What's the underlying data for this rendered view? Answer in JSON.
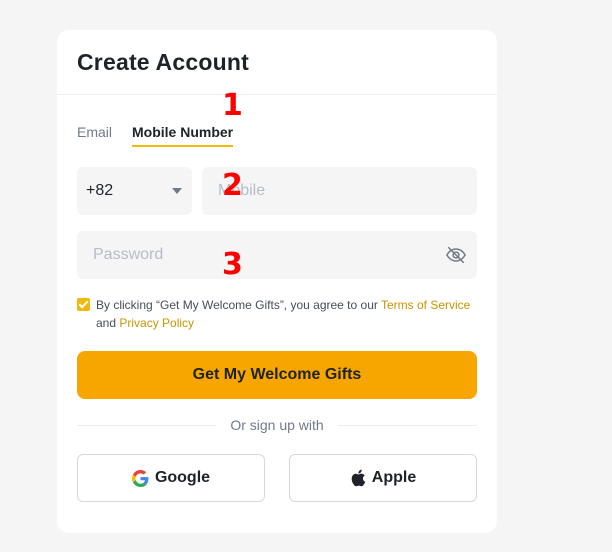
{
  "header": {
    "title": "Create Account"
  },
  "tabs": [
    {
      "label": "Email",
      "active": false
    },
    {
      "label": "Mobile Number",
      "active": true
    }
  ],
  "phone": {
    "country_code": "+82",
    "mobile_placeholder": "Mobile"
  },
  "password": {
    "placeholder": "Password"
  },
  "annotations": [
    "1",
    "2",
    "3"
  ],
  "agreement": {
    "text_before": "By clicking “Get My Welcome Gifts”, you agree to our ",
    "terms_link": "Terms of Service",
    "and_text": " and ",
    "privacy_link": "Privacy Policy",
    "checked": true
  },
  "primary_button": {
    "label": "Get My Welcome Gifts"
  },
  "divider": {
    "text": "Or sign up with"
  },
  "social": {
    "google_label": "Google",
    "apple_label": "Apple"
  },
  "colors": {
    "accent": "#f7a600",
    "link": "#c99400",
    "annotation": "#ff0000"
  },
  "icons": [
    "caret-down-icon",
    "eye-off-icon",
    "google-icon",
    "apple-icon"
  ]
}
